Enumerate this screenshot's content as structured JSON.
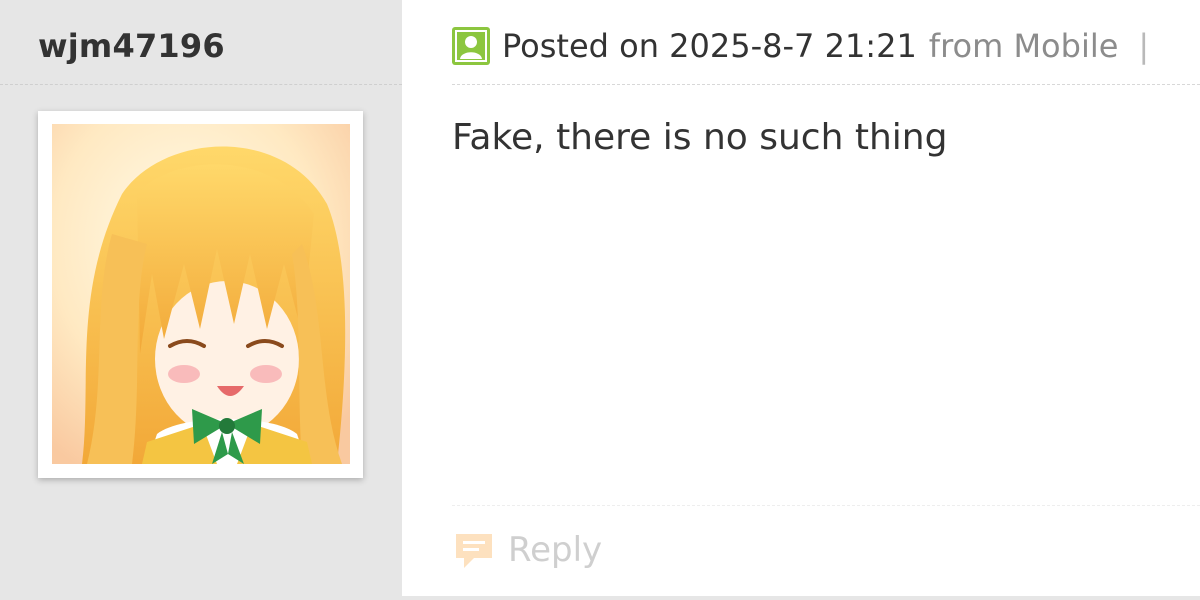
{
  "user": {
    "username": "wjm47196",
    "avatar_desc": "anime-girl-avatar"
  },
  "post": {
    "meta": {
      "posted_text": "Posted on 2025-8-7 21:21",
      "from_text": "from Mobile",
      "separator": "|"
    },
    "body": "Fake, there is no such thing",
    "reply_label": "Reply"
  },
  "colors": {
    "user_column_bg": "#e6e6e6",
    "online_icon": "#8cc63f",
    "reply_icon": "#fde1bf",
    "text_primary": "#333333",
    "text_muted": "#8c8c8c",
    "reply_text": "#cfcfcf"
  },
  "icons": {
    "online_status": "user-online-icon",
    "reply": "speech-bubble-icon"
  }
}
